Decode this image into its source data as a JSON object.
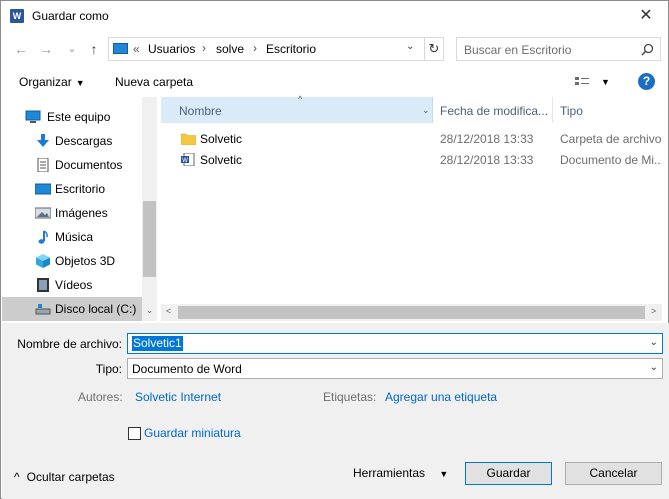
{
  "window": {
    "title": "Guardar como",
    "close_glyph": "✕"
  },
  "nav": {
    "back_glyph": "←",
    "forward_glyph": "→",
    "recent_glyph": "⌄",
    "up_glyph": "↑",
    "path_prefix": "«",
    "breadcrumbs": [
      "Usuarios",
      "solve",
      "Escritorio"
    ],
    "separator": "›",
    "refresh_glyph": "↻",
    "dropdown_glyph": "⌄"
  },
  "search": {
    "placeholder": "Buscar en Escritorio"
  },
  "toolbar": {
    "organizar_label": "Organizar",
    "nueva_carpeta_label": "Nueva carpeta",
    "help_label": "?",
    "arrow_glyph": "▼"
  },
  "sidebar": {
    "items": [
      {
        "label": "Este equipo",
        "icon": "computer-icon"
      },
      {
        "label": "Descargas",
        "icon": "download-icon"
      },
      {
        "label": "Documentos",
        "icon": "document-icon"
      },
      {
        "label": "Escritorio",
        "icon": "desktop-icon"
      },
      {
        "label": "Imágenes",
        "icon": "pictures-icon"
      },
      {
        "label": "Música",
        "icon": "music-icon"
      },
      {
        "label": "Objetos 3D",
        "icon": "cube-icon"
      },
      {
        "label": "Vídeos",
        "icon": "video-icon"
      },
      {
        "label": "Disco local (C:)",
        "icon": "drive-icon"
      }
    ],
    "scroll_down_glyph": "⌄"
  },
  "columns": {
    "name": "Nombre",
    "date": "Fecha de modifica...",
    "type": "Tipo",
    "sort_glyph": "^",
    "dd_glyph": "⌄"
  },
  "files": [
    {
      "name": "Solvetic",
      "date": "28/12/2018 13:33",
      "type": "Carpeta de archivos",
      "icon": "folder-icon"
    },
    {
      "name": "Solvetic",
      "date": "28/12/2018 13:33",
      "type": "Documento de Mi...",
      "icon": "word-doc-icon"
    }
  ],
  "hscroll": {
    "left_glyph": "<",
    "right_glyph": ">"
  },
  "form": {
    "filename_label": "Nombre de archivo:",
    "filename_value": "Solvetic1",
    "tipo_label": "Tipo:",
    "tipo_value": "Documento de Word",
    "autores_label": "Autores:",
    "autores_value": "Solvetic Internet",
    "etiquetas_label": "Etiquetas:",
    "etiquetas_value": "Agregar una etiqueta",
    "thumbnail_label": "Guardar miniatura",
    "dd_glyph": "⌄"
  },
  "footer": {
    "ocultar_label": "Ocultar carpetas",
    "ocultar_glyph": "^",
    "herramientas_label": "Herramientas",
    "herramientas_glyph": "▼",
    "guardar_label": "Guardar",
    "cancelar_label": "Cancelar"
  },
  "colors": {
    "accent": "#0078d7",
    "header_sel": "#d9ebf9",
    "nav_sel": "#cccccc",
    "link": "#0066cc",
    "panel_bg": "#f0f0f0"
  }
}
